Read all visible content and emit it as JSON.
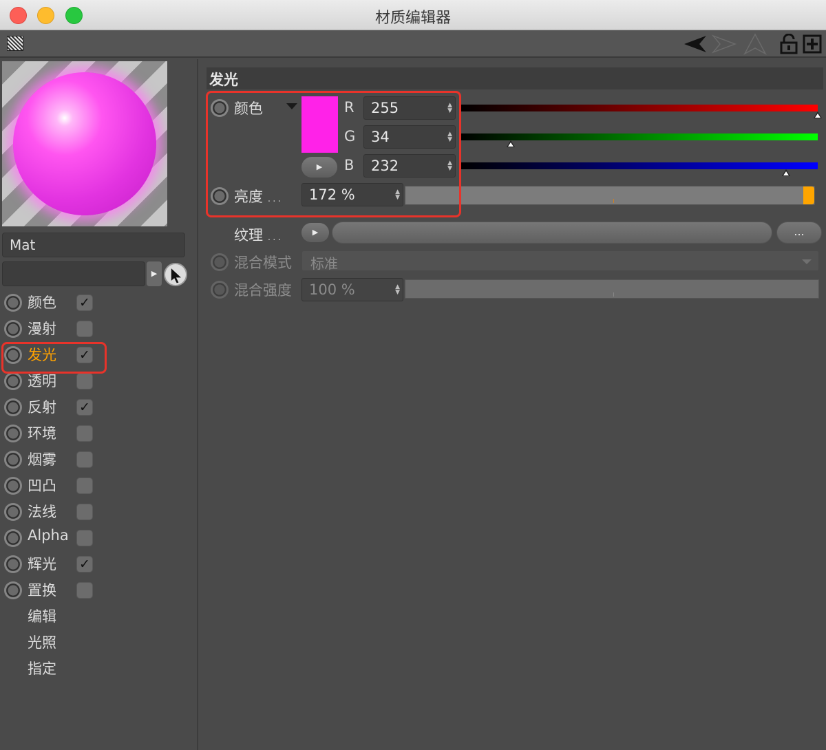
{
  "window": {
    "title": "材质编辑器"
  },
  "toolbar": {
    "icons": [
      "grid-icon",
      "back-arrow-icon",
      "forward-arrow-icon",
      "up-arrow-icon",
      "lock-icon",
      "new-window-icon"
    ]
  },
  "material": {
    "name": "Mat",
    "preview_color": "#ff55f0"
  },
  "channels": [
    {
      "label": "颜色",
      "has_check": true,
      "checked": true,
      "active": false
    },
    {
      "label": "漫射",
      "has_check": true,
      "checked": false,
      "active": false
    },
    {
      "label": "发光",
      "has_check": true,
      "checked": true,
      "active": true
    },
    {
      "label": "透明",
      "has_check": true,
      "checked": false,
      "active": false
    },
    {
      "label": "反射",
      "has_check": true,
      "checked": true,
      "active": false
    },
    {
      "label": "环境",
      "has_check": true,
      "checked": false,
      "active": false
    },
    {
      "label": "烟雾",
      "has_check": true,
      "checked": false,
      "active": false
    },
    {
      "label": "凹凸",
      "has_check": true,
      "checked": false,
      "active": false
    },
    {
      "label": "法线",
      "has_check": true,
      "checked": false,
      "active": false
    },
    {
      "label": "Alpha",
      "has_check": true,
      "checked": false,
      "active": false
    },
    {
      "label": "辉光",
      "has_check": true,
      "checked": true,
      "active": false
    },
    {
      "label": "置换",
      "has_check": true,
      "checked": false,
      "active": false
    },
    {
      "label": "编辑",
      "has_check": false
    },
    {
      "label": "光照",
      "has_check": false
    },
    {
      "label": "指定",
      "has_check": false
    }
  ],
  "check_glyph": "✓",
  "section": {
    "title": "发光"
  },
  "color": {
    "label": "颜色",
    "swatch": "#ff22e8",
    "r_label": "R",
    "r_value": "255",
    "r_fraction": 1.0,
    "g_label": "G",
    "g_value": "34",
    "g_fraction": 0.133,
    "b_label": "B",
    "b_value": "232",
    "b_fraction": 0.91
  },
  "brightness": {
    "label": "亮度",
    "dots": "...",
    "value": "172 %",
    "fraction": 1.0,
    "accent": "#ffa500"
  },
  "texture": {
    "label": "纹理",
    "dots": "...",
    "button": "..."
  },
  "blend_mode": {
    "label": "混合模式",
    "value": "标准"
  },
  "blend_strength": {
    "label": "混合强度",
    "value": "100 %"
  }
}
